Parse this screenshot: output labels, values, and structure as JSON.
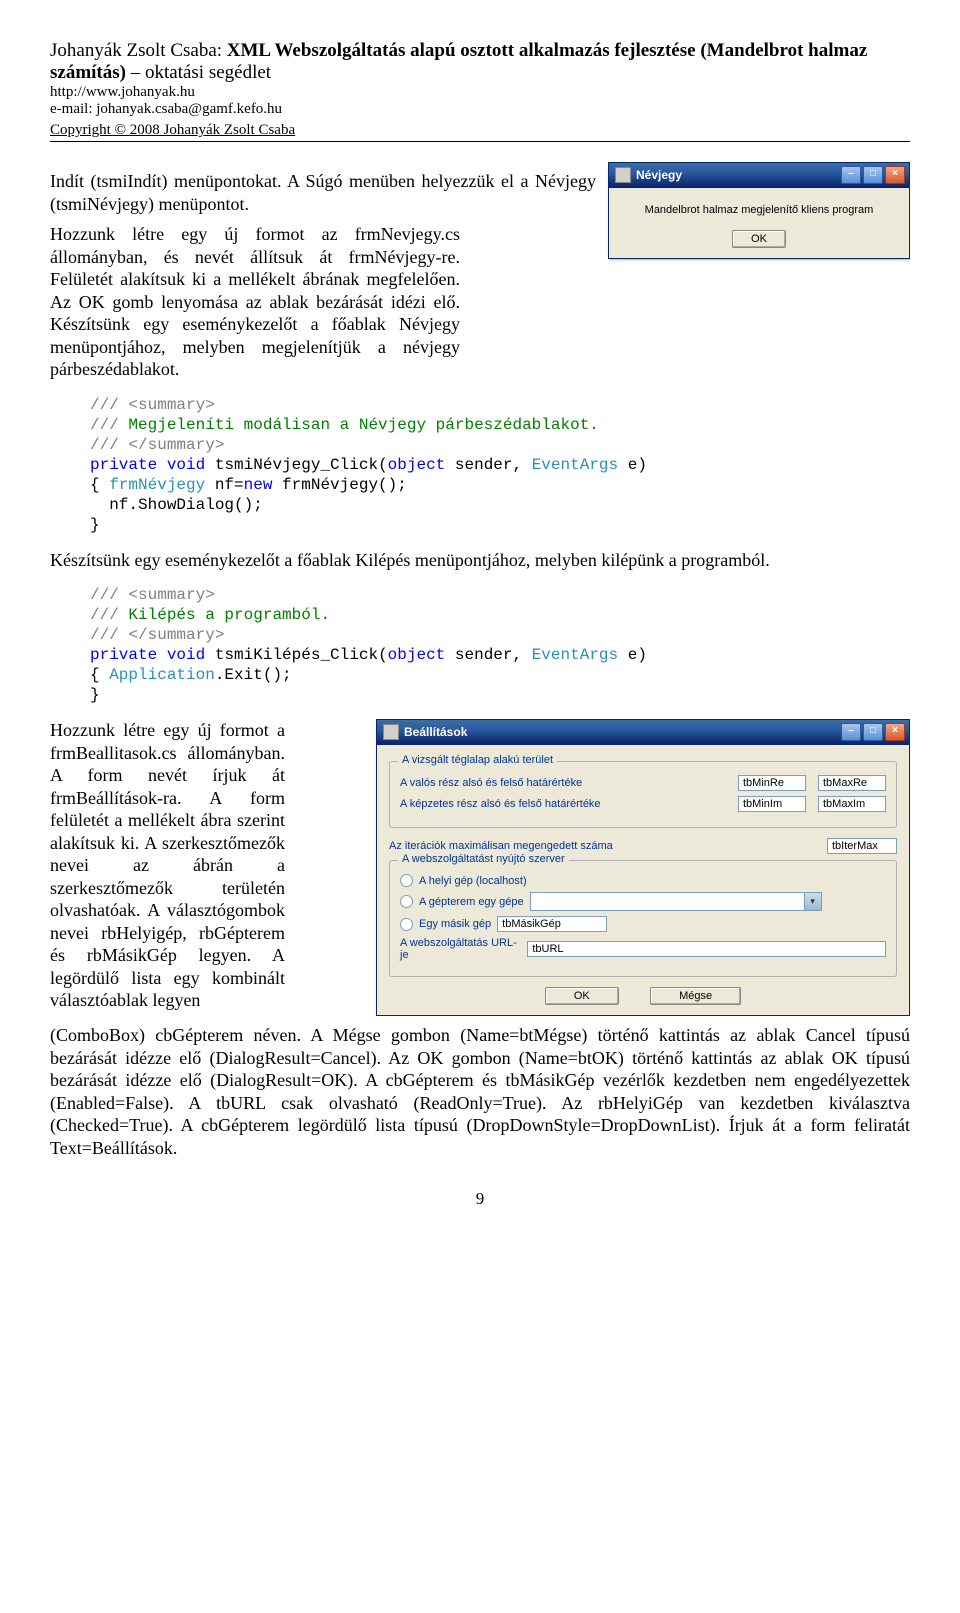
{
  "header": {
    "author": "Johanyák Zsolt Csaba: ",
    "title_bold": "XML Webszolgáltatás alapú osztott alkalmazás fejlesztése (Mandelbrot halmaz számítás)",
    "title_rest": "– oktatási segédlet",
    "url": "http://www.johanyak.hu",
    "email": "e-mail: johanyak.csaba@gamf.kefo.hu",
    "copyright": "Copyright © 2008 Johanyák Zsolt Csaba"
  },
  "para1_a": "Indít (tsmiIndít) menüpontokat. A Súgó menüben helyezzük el a Névjegy (tsmiNévjegy) menüpontot.",
  "para1_b": "Hozzunk létre egy új formot az frmNevjegy.cs állományban, és nevét állítsuk át frmNévjegy-re. Felületét alakítsuk ki a mellékelt ábrának megfelelően. Az OK gomb lenyomása az ablak bezárását idézi elő. Készítsünk egy eseménykezelőt a főablak Névjegy menüpontjához, melyben megjelenítjük a névjegy párbeszédablakot.",
  "nevjegy_window": {
    "title": "Névjegy",
    "message": "Mandelbrot halmaz megjelenítő kliens program",
    "ok": "OK"
  },
  "code1": {
    "c1": "/// <summary>",
    "c2": "/// Megjeleníti modálisan a Névjegy párbeszédablakot.",
    "c3": "/// </summary>",
    "kw_private": "private",
    "kw_void": "void",
    "m_name": " tsmiNévjegy_Click(",
    "kw_object": "object",
    "m_mid": " sender, ",
    "t_eventargs": "EventArgs",
    "m_end": " e)",
    "l_open": "{ ",
    "t_frm": "frmNévjegy",
    "l_mid": " nf=",
    "kw_new": "new",
    "l_ctor": " frmNévjegy();",
    "l_show": "  nf.ShowDialog();",
    "l_close": "}"
  },
  "para2": "Készítsünk egy eseménykezelőt a főablak Kilépés menüpontjához, melyben kilépünk a programból.",
  "code2": {
    "c1": "/// <summary>",
    "c2": "/// Kilépés a programból.",
    "c3": "/// </summary>",
    "kw_private": "private",
    "kw_void": "void",
    "m_name": " tsmiKilépés_Click(",
    "kw_object": "object",
    "m_mid": " sender, ",
    "t_eventargs": "EventArgs",
    "m_end": " e)",
    "l_open": "{ ",
    "t_app": "Application",
    "l_exit": ".Exit();",
    "l_close": "}"
  },
  "beall_window": {
    "title": "Beállítások",
    "group1": "A vizsgált téglalap alakú terület",
    "g1_row1": "A valós rész alsó és felső határértéke",
    "g1_row2": "A képzetes rész alsó és felső határértéke",
    "tbMinRe": "tbMinRe",
    "tbMaxRe": "tbMaxRe",
    "tbMinIm": "tbMinIm",
    "tbMaxIm": "tbMaxIm",
    "iter_label": "Az iterációk maximálisan megengedett száma",
    "tbIterMax": "tbIterMax",
    "group2": "A webszolgáltatást nyújtó szerver",
    "rb1": "A helyi gép (localhost)",
    "rb2": "A gépterem egy gépe",
    "rb3": "Egy másik gép",
    "tbMasikGep": "tbMásikGép",
    "url_label": "A webszolgáltatás URL-je",
    "tbURL": "tbURL",
    "ok": "OK",
    "cancel": "Mégse"
  },
  "para3_a": "Hozzunk létre egy új formot a frmBeallitasok.cs állományban. A form nevét írjuk át frmBeállítások-ra. A form felületét a mellékelt ábra szerint alakítsuk ki. A szerkesztőmezők nevei az ábrán a szerkesztőmezők területén olvashatóak. A választógombok nevei rbHelyigép, rbGépterem és rbMásikGép legyen. A legördülő lista egy kombinált választóablak legyen",
  "para3_b": "(ComboBox) cbGépterem néven. A Mégse gombon (Name=btMégse) történő kattintás az ablak Cancel típusú bezárását idézze elő (DialogResult=Cancel). Az OK gombon (Name=btOK) történő kattintás az ablak OK típusú bezárását idézze elő (DialogResult=OK). A cbGépterem és tbMásikGép vezérlők kezdetben nem engedélyezettek (Enabled=False). A tbURL csak olvasható (ReadOnly=True). Az rbHelyiGép van kezdetben kiválasztva (Checked=True). A cbGépterem legördülő lista típusú (DropDownStyle=DropDownList). Írjuk át a form feliratát Text=Beállítások.",
  "pagenum": "9"
}
